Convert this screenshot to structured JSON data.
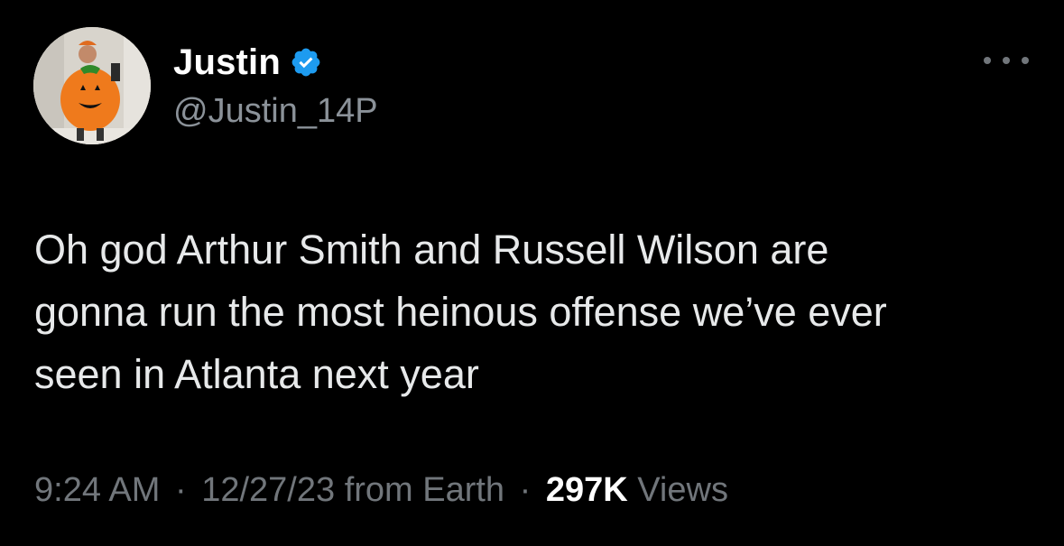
{
  "author": {
    "display_name": "Justin",
    "handle": "@Justin_14P",
    "verified": true,
    "avatar_icon": "profile-photo-pumpkin-costume"
  },
  "tweet": {
    "text": "Oh god Arthur Smith and Russell Wilson are\ngonna run the most heinous offense we’ve ever\nseen in Atlanta next year"
  },
  "meta": {
    "time": "9:24 AM",
    "separator": "·",
    "date": "12/27/23",
    "location": "from Earth",
    "views_count": "297K",
    "views_label": "Views"
  },
  "colors": {
    "background": "#000000",
    "verified_badge": "#1d9bf0",
    "secondary_text": "#71767b",
    "primary_text": "#e7e9ea"
  }
}
